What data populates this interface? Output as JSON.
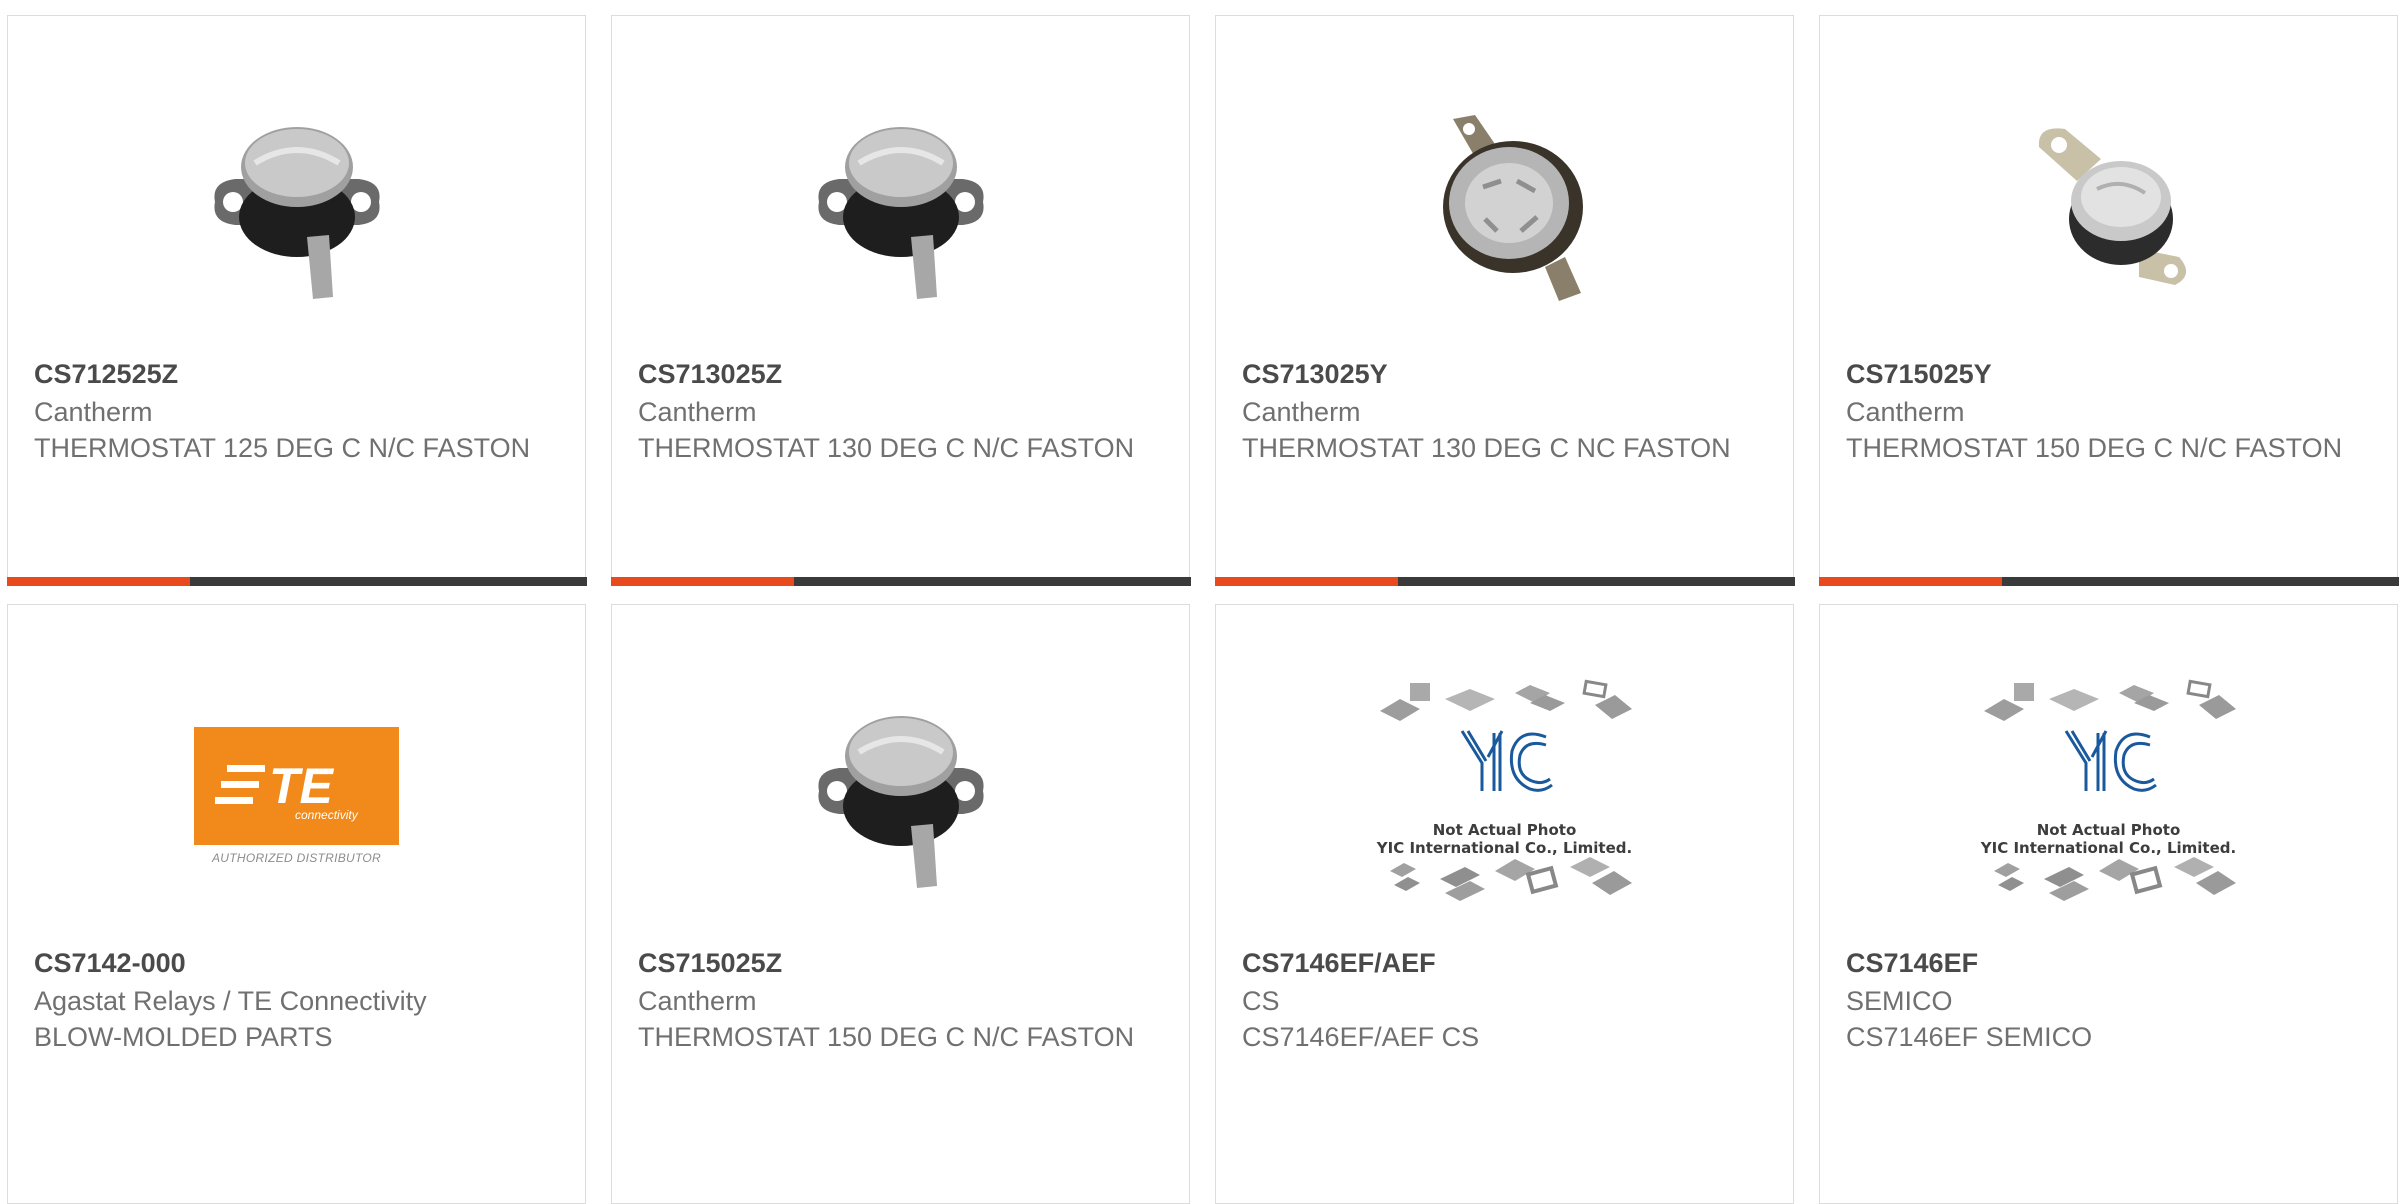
{
  "accent_color": "#e8491d",
  "products": [
    {
      "part_number": "CS712525Z",
      "manufacturer": "Cantherm",
      "description": "THERMOSTAT 125 DEG C N/C FASTON",
      "image": "thermostat-photo-icon"
    },
    {
      "part_number": "CS713025Z",
      "manufacturer": "Cantherm",
      "description": "THERMOSTAT 130 DEG C N/C FASTON",
      "image": "thermostat-photo-icon"
    },
    {
      "part_number": "CS713025Y",
      "manufacturer": "Cantherm",
      "description": "THERMOSTAT 130 DEG C NC FASTON",
      "image": "thermostat-flat-photo-icon"
    },
    {
      "part_number": "CS715025Y",
      "manufacturer": "Cantherm",
      "description": "THERMOSTAT 150 DEG C N/C FASTON",
      "image": "thermostat-angled-photo-icon"
    },
    {
      "part_number": "CS7142-000",
      "manufacturer": "Agastat Relays / TE Connectivity",
      "description": "BLOW-MOLDED PARTS",
      "image": "te-logo",
      "logo_text": "TE connectivity",
      "logo_caption": "AUTHORIZED DISTRIBUTOR"
    },
    {
      "part_number": "CS715025Z",
      "manufacturer": "Cantherm",
      "description": "THERMOSTAT 150 DEG C N/C FASTON",
      "image": "thermostat-photo-icon"
    },
    {
      "part_number": "CS7146EF/AEF",
      "manufacturer": "CS",
      "description": "CS7146EF/AEF CS",
      "image": "yic-placeholder",
      "placeholder_line1": "Not Actual Photo",
      "placeholder_line2": "YIC International Co., Limited."
    },
    {
      "part_number": "CS7146EF",
      "manufacturer": "SEMICO",
      "description": "CS7146EF SEMICO",
      "image": "yic-placeholder",
      "placeholder_line1": "Not Actual Photo",
      "placeholder_line2": "YIC International Co., Limited."
    }
  ]
}
